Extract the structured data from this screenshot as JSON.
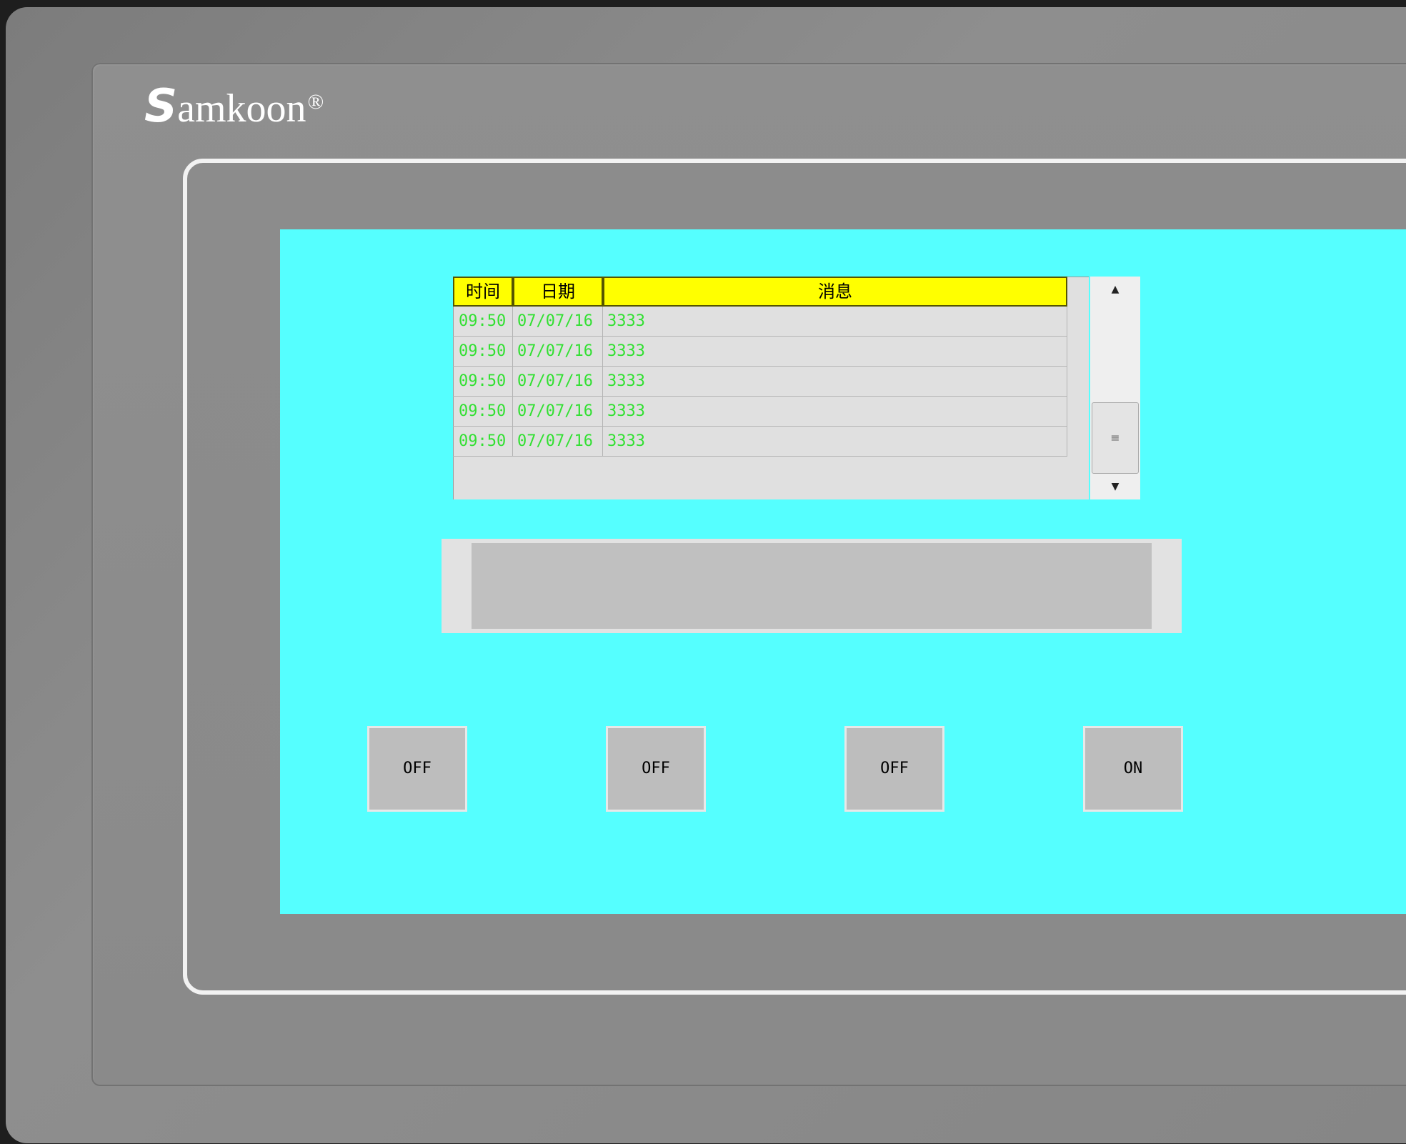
{
  "brand": {
    "logo_initial": "S",
    "logo_rest": "amkoon",
    "registered_mark": "®"
  },
  "alarm_table": {
    "headers": [
      "时间",
      "日期",
      "消息"
    ],
    "rows": [
      {
        "time": "09:50",
        "date": "07/07/16",
        "message": "3333"
      },
      {
        "time": "09:50",
        "date": "07/07/16",
        "message": "3333"
      },
      {
        "time": "09:50",
        "date": "07/07/16",
        "message": "3333"
      },
      {
        "time": "09:50",
        "date": "07/07/16",
        "message": "3333"
      },
      {
        "time": "09:50",
        "date": "07/07/16",
        "message": "3333"
      }
    ],
    "scroll_up_icon": "▲",
    "scroll_down_icon": "▼",
    "scroll_thumb_icon": "≡"
  },
  "message_bar": {
    "text": ""
  },
  "buttons": [
    {
      "label": "OFF"
    },
    {
      "label": "OFF"
    },
    {
      "label": "OFF"
    },
    {
      "label": "ON"
    }
  ],
  "colors": {
    "screen_bg": "#55ffff",
    "header_bg": "#ffff00",
    "row_text": "#33e033",
    "button_bg": "#bdbdbd"
  }
}
